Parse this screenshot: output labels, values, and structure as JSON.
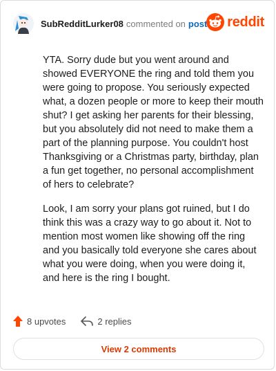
{
  "comment": {
    "username": "SubRedditLurker08",
    "commented_on": "commented on",
    "post_link": "post",
    "paragraphs": [
      "YTA. Sorry dude but you went around and showed EVERYONE the ring and told them you were going to propose. You seriously expected what, a dozen people or more to keep their mouth shut? I get asking her parents for their blessing, but you absolutely did not need to make them a part of the planning purpose. You couldn't host Thanksgiving or a Christmas party, birthday, plan a fun get together, no personal accomplishment of hers to celebrate?",
      "Look, I am sorry your plans got ruined, but I do think this was a crazy way to go about it. Not to mention most women like showing off the ring and you basically told everyone she cares about what you were doing, when you were doing it, and here is the ring I bought."
    ]
  },
  "brand": {
    "name": "reddit",
    "color": "#ff4500"
  },
  "actions": {
    "upvotes": "8 upvotes",
    "replies": "2 replies"
  },
  "footer": {
    "view_comments": "View 2 comments"
  },
  "icons": {
    "avatar": "avatar-icon",
    "logo": "reddit-snoo-icon",
    "upvote": "upvote-arrow-icon",
    "reply": "reply-arrow-icon"
  }
}
